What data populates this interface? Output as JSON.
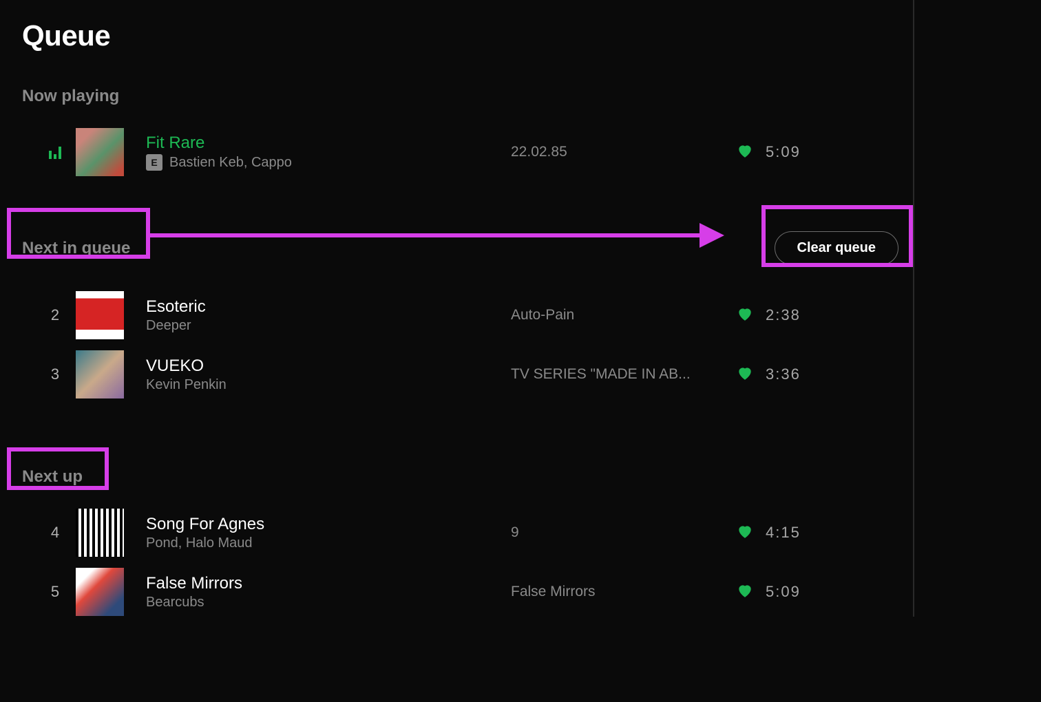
{
  "header": {
    "title": "Queue"
  },
  "sections": {
    "now_playing_label": "Now playing",
    "next_in_queue_label": "Next in queue",
    "next_up_label": "Next up",
    "clear_queue_label": "Clear queue"
  },
  "now_playing": {
    "title": "Fit Rare",
    "artist": "Bastien Keb, Cappo",
    "album": "22.02.85",
    "duration": "5:09",
    "explicit": "E",
    "liked": true
  },
  "next_in_queue": [
    {
      "index": "2",
      "title": "Esoteric",
      "artist": "Deeper",
      "album": "Auto-Pain",
      "duration": "2:38",
      "liked": true
    },
    {
      "index": "3",
      "title": "VUEKO",
      "artist": "Kevin Penkin",
      "album": "TV SERIES \"MADE IN AB...",
      "duration": "3:36",
      "liked": true
    }
  ],
  "next_up": [
    {
      "index": "4",
      "title": "Song For Agnes",
      "artist": "Pond, Halo Maud",
      "album": "9",
      "duration": "4:15",
      "liked": true
    },
    {
      "index": "5",
      "title": "False Mirrors",
      "artist": "Bearcubs",
      "album": "False Mirrors",
      "duration": "5:09",
      "liked": true
    }
  ],
  "annotation": {
    "highlights": [
      "Next in queue",
      "Clear queue",
      "Next up"
    ]
  }
}
